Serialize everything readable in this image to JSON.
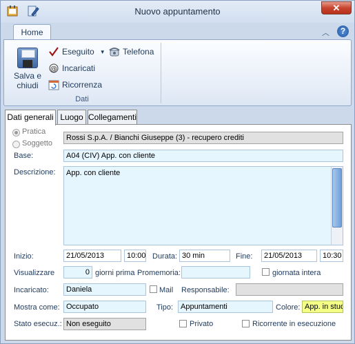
{
  "window": {
    "title": "Nuovo appuntamento",
    "close": "✕"
  },
  "ribbon": {
    "tab": "Home",
    "save_label_1": "Salva e",
    "save_label_2": "chiudi",
    "eseguito": "Eseguito",
    "telefona": "Telefona",
    "incaricati": "Incaricati",
    "ricorrenza": "Ricorrenza",
    "group": "Dati"
  },
  "panel_tabs": [
    "Dati generali",
    "Luogo",
    "Collegamenti"
  ],
  "form": {
    "pratica_label": "Pratica",
    "soggetto_label": "Soggetto",
    "pratica_value": "Rossi S.p.A. / Bianchi Giuseppe (3) - recupero crediti",
    "base_label": "Base:",
    "base_value": "A04 (CIV) App. con cliente",
    "descrizione_label": "Descrizione:",
    "descrizione_value": "App. con cliente",
    "inizio_label": "Inizio:",
    "inizio_date": "21/05/2013",
    "inizio_time": "10:00",
    "durata_label": "Durata:",
    "durata_value": "30 min",
    "fine_label": "Fine:",
    "fine_date": "21/05/2013",
    "fine_time": "10:30",
    "visualizzare_label": "Visualizzare",
    "visualizzare_value": "0",
    "giorni_prima": "giorni prima",
    "promemoria_label": "Promemoria:",
    "promemoria_value": "",
    "giornata_intera": "giornata intera",
    "incaricato_label": "Incaricato:",
    "incaricato_value": "Daniela",
    "mail_label": "Mail",
    "responsabile_label": "Responsabile:",
    "responsabile_value": "",
    "mostra_come_label": "Mostra come:",
    "mostra_come_value": "Occupato",
    "tipo_label": "Tipo:",
    "tipo_value": "Appuntamenti",
    "colore_label": "Colore:",
    "colore_value": "App. in studio",
    "stato_label": "Stato esecuz.:",
    "stato_value": "Non eseguito",
    "privato_label": "Privato",
    "ricorrente_label": "Ricorrente in esecuzione"
  }
}
